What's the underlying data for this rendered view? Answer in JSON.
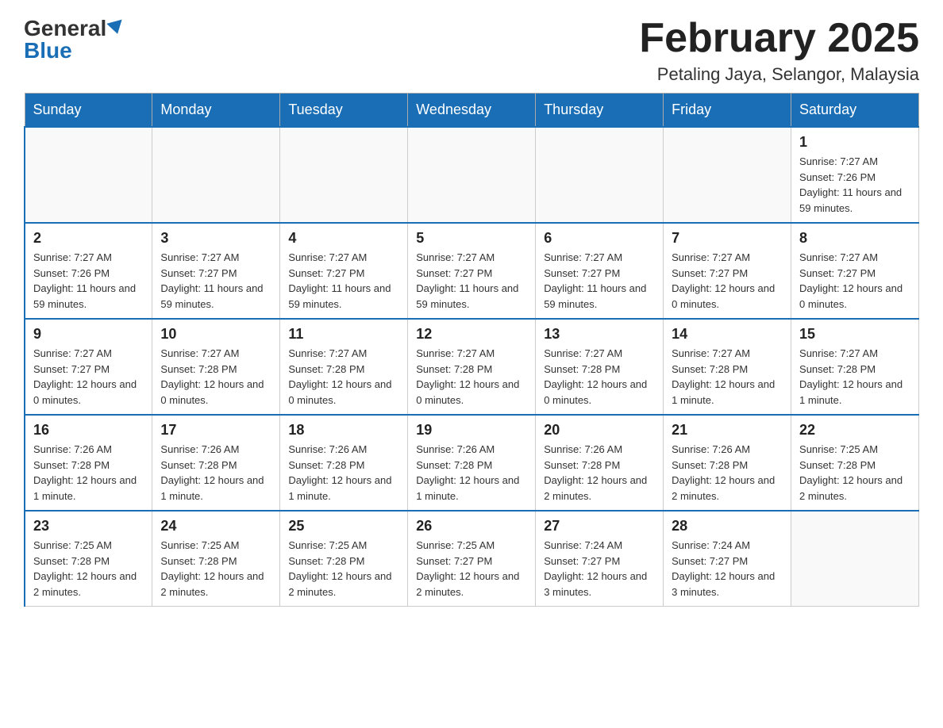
{
  "header": {
    "logo_general": "General",
    "logo_blue": "Blue",
    "month_title": "February 2025",
    "location": "Petaling Jaya, Selangor, Malaysia"
  },
  "weekdays": [
    "Sunday",
    "Monday",
    "Tuesday",
    "Wednesday",
    "Thursday",
    "Friday",
    "Saturday"
  ],
  "weeks": [
    [
      {
        "day": "",
        "info": ""
      },
      {
        "day": "",
        "info": ""
      },
      {
        "day": "",
        "info": ""
      },
      {
        "day": "",
        "info": ""
      },
      {
        "day": "",
        "info": ""
      },
      {
        "day": "",
        "info": ""
      },
      {
        "day": "1",
        "info": "Sunrise: 7:27 AM\nSunset: 7:26 PM\nDaylight: 11 hours and 59 minutes."
      }
    ],
    [
      {
        "day": "2",
        "info": "Sunrise: 7:27 AM\nSunset: 7:26 PM\nDaylight: 11 hours and 59 minutes."
      },
      {
        "day": "3",
        "info": "Sunrise: 7:27 AM\nSunset: 7:27 PM\nDaylight: 11 hours and 59 minutes."
      },
      {
        "day": "4",
        "info": "Sunrise: 7:27 AM\nSunset: 7:27 PM\nDaylight: 11 hours and 59 minutes."
      },
      {
        "day": "5",
        "info": "Sunrise: 7:27 AM\nSunset: 7:27 PM\nDaylight: 11 hours and 59 minutes."
      },
      {
        "day": "6",
        "info": "Sunrise: 7:27 AM\nSunset: 7:27 PM\nDaylight: 11 hours and 59 minutes."
      },
      {
        "day": "7",
        "info": "Sunrise: 7:27 AM\nSunset: 7:27 PM\nDaylight: 12 hours and 0 minutes."
      },
      {
        "day": "8",
        "info": "Sunrise: 7:27 AM\nSunset: 7:27 PM\nDaylight: 12 hours and 0 minutes."
      }
    ],
    [
      {
        "day": "9",
        "info": "Sunrise: 7:27 AM\nSunset: 7:27 PM\nDaylight: 12 hours and 0 minutes."
      },
      {
        "day": "10",
        "info": "Sunrise: 7:27 AM\nSunset: 7:28 PM\nDaylight: 12 hours and 0 minutes."
      },
      {
        "day": "11",
        "info": "Sunrise: 7:27 AM\nSunset: 7:28 PM\nDaylight: 12 hours and 0 minutes."
      },
      {
        "day": "12",
        "info": "Sunrise: 7:27 AM\nSunset: 7:28 PM\nDaylight: 12 hours and 0 minutes."
      },
      {
        "day": "13",
        "info": "Sunrise: 7:27 AM\nSunset: 7:28 PM\nDaylight: 12 hours and 0 minutes."
      },
      {
        "day": "14",
        "info": "Sunrise: 7:27 AM\nSunset: 7:28 PM\nDaylight: 12 hours and 1 minute."
      },
      {
        "day": "15",
        "info": "Sunrise: 7:27 AM\nSunset: 7:28 PM\nDaylight: 12 hours and 1 minute."
      }
    ],
    [
      {
        "day": "16",
        "info": "Sunrise: 7:26 AM\nSunset: 7:28 PM\nDaylight: 12 hours and 1 minute."
      },
      {
        "day": "17",
        "info": "Sunrise: 7:26 AM\nSunset: 7:28 PM\nDaylight: 12 hours and 1 minute."
      },
      {
        "day": "18",
        "info": "Sunrise: 7:26 AM\nSunset: 7:28 PM\nDaylight: 12 hours and 1 minute."
      },
      {
        "day": "19",
        "info": "Sunrise: 7:26 AM\nSunset: 7:28 PM\nDaylight: 12 hours and 1 minute."
      },
      {
        "day": "20",
        "info": "Sunrise: 7:26 AM\nSunset: 7:28 PM\nDaylight: 12 hours and 2 minutes."
      },
      {
        "day": "21",
        "info": "Sunrise: 7:26 AM\nSunset: 7:28 PM\nDaylight: 12 hours and 2 minutes."
      },
      {
        "day": "22",
        "info": "Sunrise: 7:25 AM\nSunset: 7:28 PM\nDaylight: 12 hours and 2 minutes."
      }
    ],
    [
      {
        "day": "23",
        "info": "Sunrise: 7:25 AM\nSunset: 7:28 PM\nDaylight: 12 hours and 2 minutes."
      },
      {
        "day": "24",
        "info": "Sunrise: 7:25 AM\nSunset: 7:28 PM\nDaylight: 12 hours and 2 minutes."
      },
      {
        "day": "25",
        "info": "Sunrise: 7:25 AM\nSunset: 7:28 PM\nDaylight: 12 hours and 2 minutes."
      },
      {
        "day": "26",
        "info": "Sunrise: 7:25 AM\nSunset: 7:27 PM\nDaylight: 12 hours and 2 minutes."
      },
      {
        "day": "27",
        "info": "Sunrise: 7:24 AM\nSunset: 7:27 PM\nDaylight: 12 hours and 3 minutes."
      },
      {
        "day": "28",
        "info": "Sunrise: 7:24 AM\nSunset: 7:27 PM\nDaylight: 12 hours and 3 minutes."
      },
      {
        "day": "",
        "info": ""
      }
    ]
  ]
}
